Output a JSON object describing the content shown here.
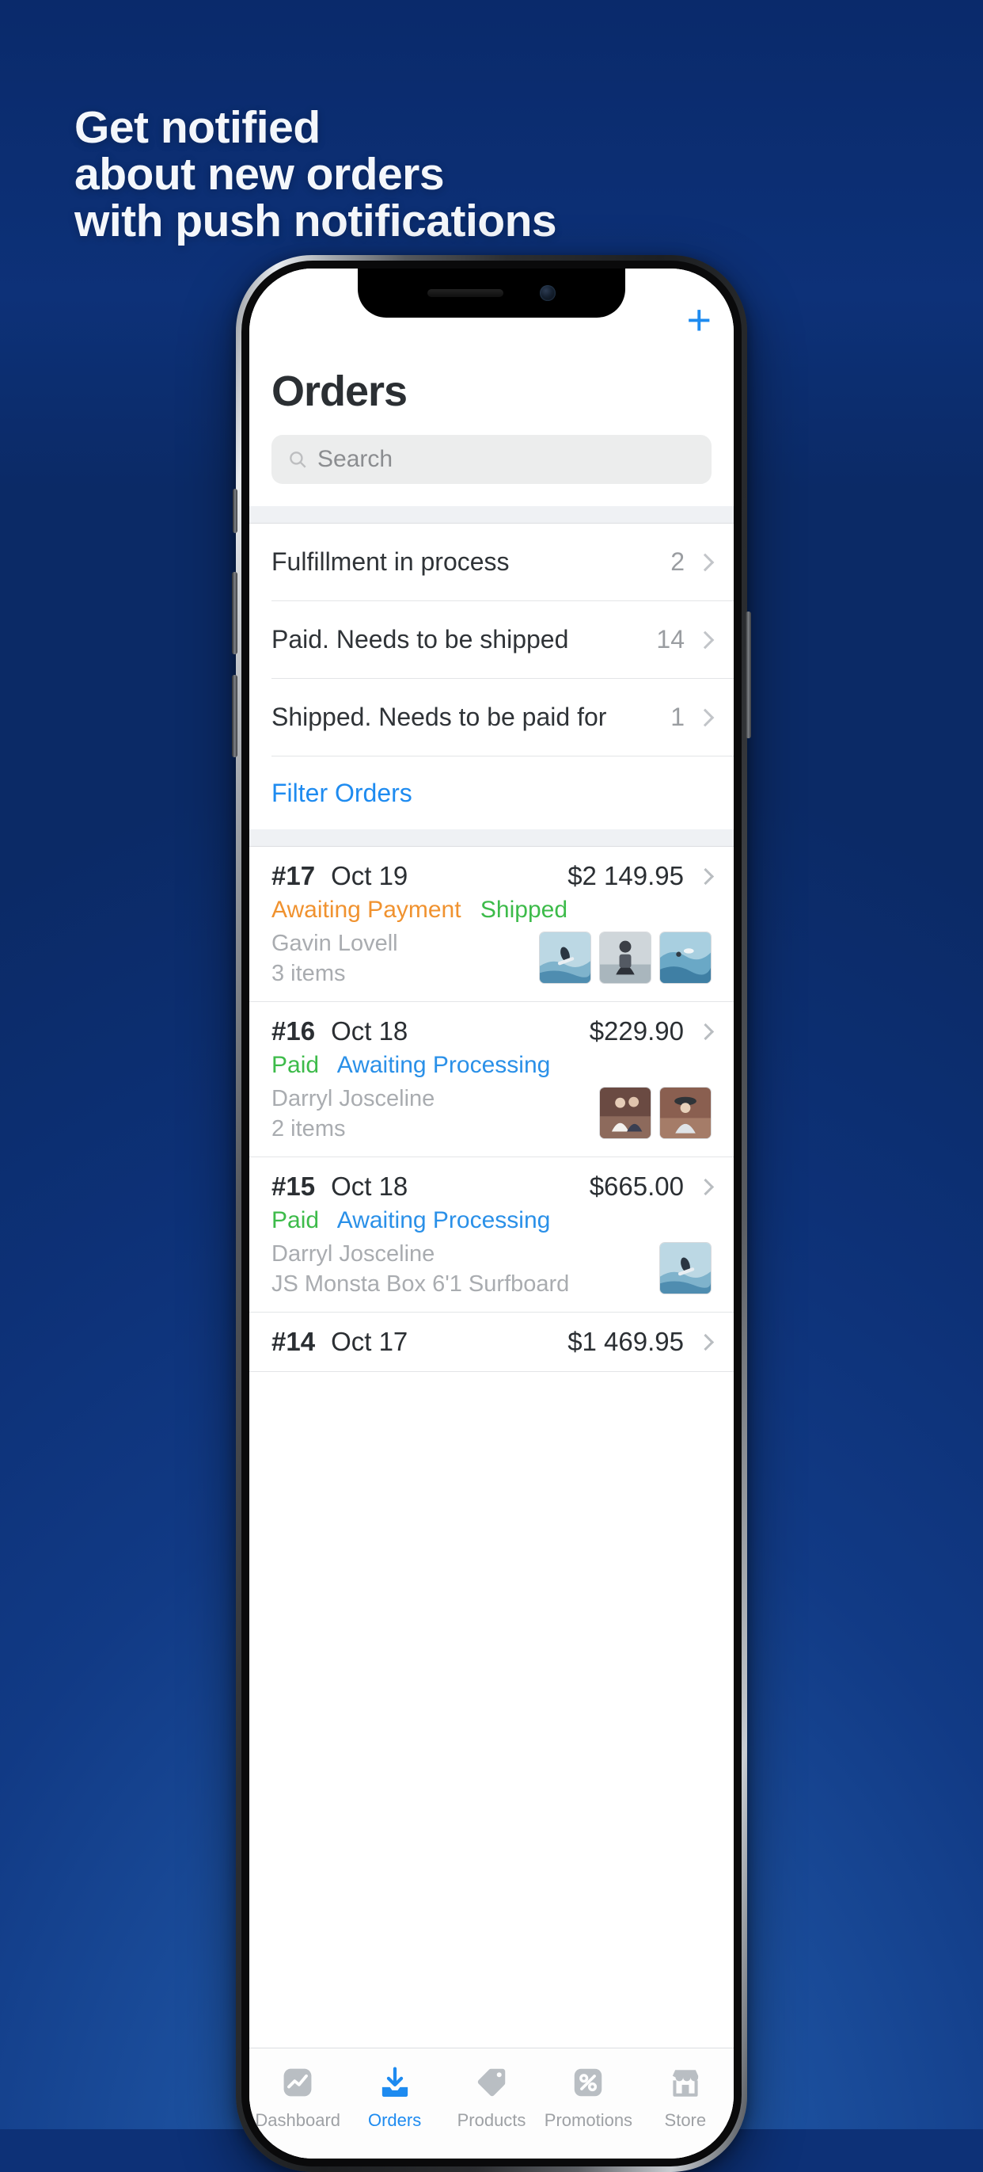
{
  "promo": {
    "background_color": "#0d3177",
    "headline_lines": [
      "Get notified",
      "about new orders",
      "with push notifications"
    ]
  },
  "app": {
    "accent_color": "#1e8bf0",
    "nav": {
      "add_label": "+"
    },
    "page_title": "Orders",
    "search": {
      "placeholder": "Search",
      "value": "",
      "icon": "search-icon"
    },
    "status_filters": [
      {
        "label": "Fulfillment in process",
        "count": "2"
      },
      {
        "label": "Paid. Needs to be shipped",
        "count": "14"
      },
      {
        "label": "Shipped. Needs to be paid for",
        "count": "1"
      }
    ],
    "filter_orders_label": "Filter Orders",
    "orders": [
      {
        "number": "#17",
        "date": "Oct 19",
        "total": "$2 149.95",
        "tags": [
          {
            "text": "Awaiting Payment",
            "color": "#f0922f"
          },
          {
            "text": "Shipped",
            "color": "#3dbb4a"
          }
        ],
        "customer": "Gavin Lovell",
        "items_label": "3 items",
        "thumb_count": 3
      },
      {
        "number": "#16",
        "date": "Oct 18",
        "total": "$229.90",
        "tags": [
          {
            "text": "Paid",
            "color": "#3dbb4a"
          },
          {
            "text": "Awaiting Processing",
            "color": "#2a90e8"
          }
        ],
        "customer": "Darryl Josceline",
        "items_label": "2 items",
        "thumb_count": 2
      },
      {
        "number": "#15",
        "date": "Oct 18",
        "total": "$665.00",
        "tags": [
          {
            "text": "Paid",
            "color": "#3dbb4a"
          },
          {
            "text": "Awaiting Processing",
            "color": "#2a90e8"
          }
        ],
        "customer": "Darryl Josceline",
        "items_label": "JS Monsta Box 6'1 Surfboard",
        "thumb_count": 1
      },
      {
        "number": "#14",
        "date": "Oct 17",
        "total": "$1 469.95",
        "tags": [],
        "customer": "",
        "items_label": "",
        "thumb_count": 0
      }
    ],
    "tabs": [
      {
        "label": "Dashboard",
        "icon": "chart-line-icon",
        "active": false
      },
      {
        "label": "Orders",
        "icon": "inbox-download-icon",
        "active": true
      },
      {
        "label": "Products",
        "icon": "price-tag-icon",
        "active": false
      },
      {
        "label": "Promotions",
        "icon": "percent-tag-icon",
        "active": false
      },
      {
        "label": "Store",
        "icon": "storefront-icon",
        "active": false
      }
    ]
  }
}
